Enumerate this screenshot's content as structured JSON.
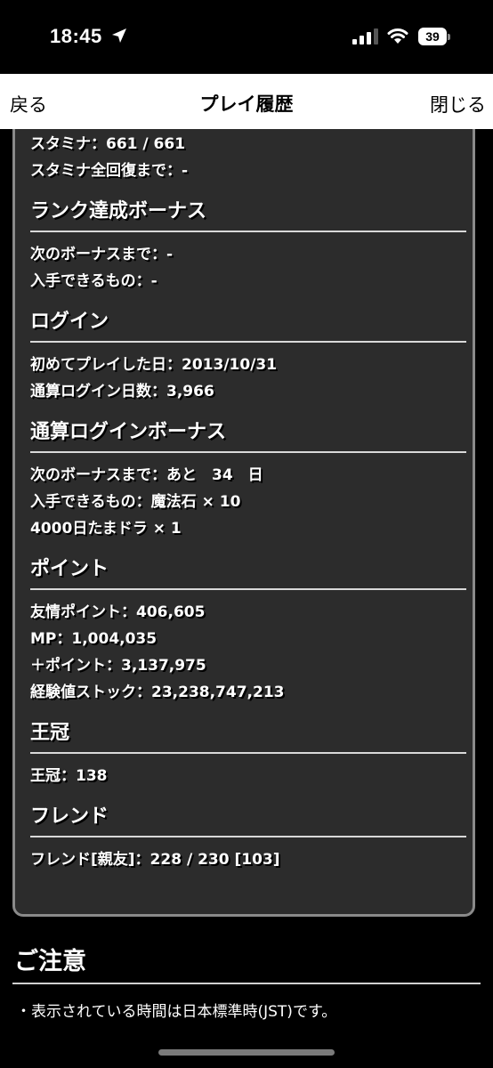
{
  "status": {
    "time": "18:45",
    "battery": "39",
    "icons": [
      "location-arrow-icon",
      "cellular-signal-icon",
      "wifi-icon",
      "battery-icon"
    ]
  },
  "nav": {
    "back": "戻る",
    "title": "プレイ履歴",
    "close": "閉じる"
  },
  "stamina": {
    "current": "スタミナ：661 / 661",
    "full_recovery": "スタミナ全回復まで：-"
  },
  "rank_bonus": {
    "title": "ランク達成ボーナス",
    "next": "次のボーナスまで：-",
    "reward": "入手できるもの：-"
  },
  "login": {
    "title": "ログイン",
    "first_play": "初めてプレイした日：2013/10/31",
    "total_days": "通算ログイン日数：3,966"
  },
  "login_bonus": {
    "title": "通算ログインボーナス",
    "next": "次のボーナスまで：あと　34　日",
    "reward1": "入手できるもの：魔法石 × 10",
    "reward2": "4000日たまドラ × 1"
  },
  "points": {
    "title": "ポイント",
    "friendship": "友情ポイント：406,605",
    "mp": "MP：1,004,035",
    "plus": "＋ポイント：3,137,975",
    "exp_stock": "経験値ストック：23,238,747,213"
  },
  "crown": {
    "title": "王冠",
    "count": "王冠：138"
  },
  "friends": {
    "title": "フレンド",
    "count": "フレンド[親友]：228 / 230 [103]"
  },
  "notes": {
    "title": "ご注意",
    "text": "・表示されている時間は日本標準時(JST)です。"
  },
  "colors": {
    "panel_bg": "#2c2c2c",
    "panel_border": "#8a8a8a",
    "page_bg": "#000000",
    "nav_bg": "#ffffff"
  }
}
